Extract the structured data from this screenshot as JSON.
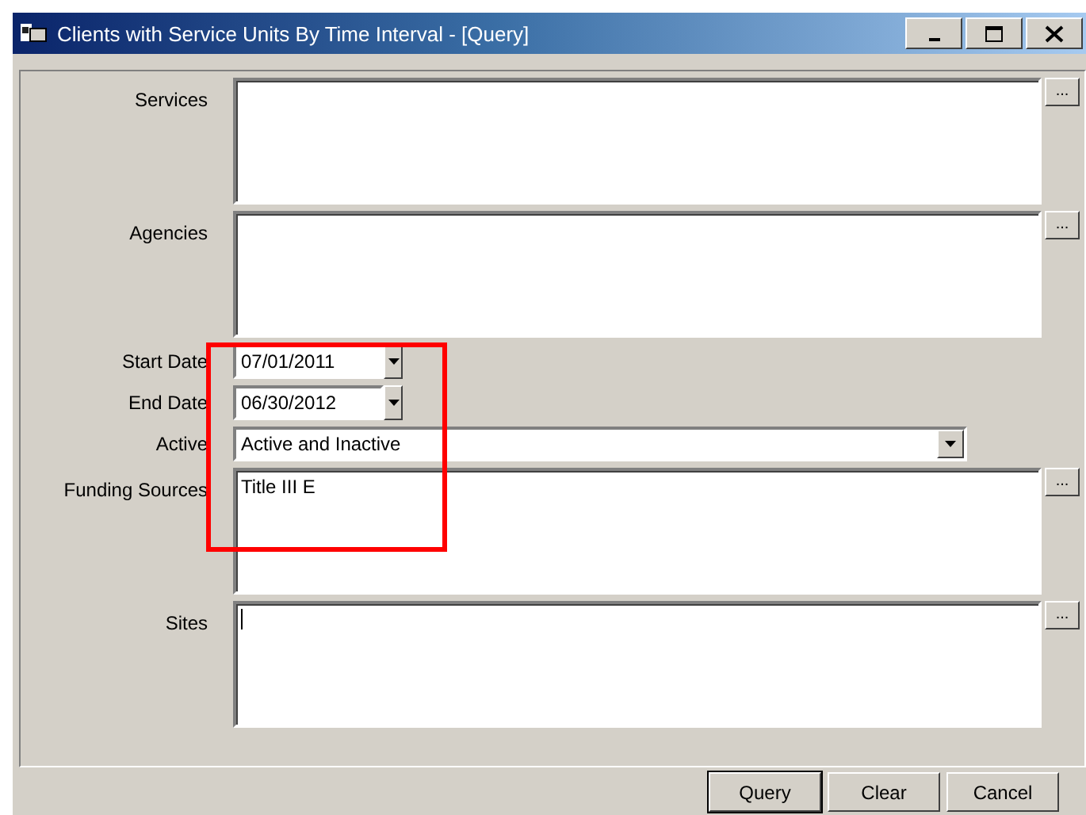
{
  "window": {
    "title": "Clients with Service Units By Time Interval - [Query]"
  },
  "fields": [
    {
      "label": "Services",
      "kind": "list",
      "browse": "..."
    },
    {
      "label": "Agencies",
      "kind": "list",
      "browse": "..."
    },
    {
      "label": "Start Date",
      "kind": "date",
      "value": "07/01/2011"
    },
    {
      "label": "End Date",
      "kind": "date",
      "value": "06/30/2012"
    },
    {
      "label": "Active",
      "kind": "combo",
      "value": "Active and Inactive"
    },
    {
      "label": "Funding Sources",
      "kind": "list",
      "value": "Title III E",
      "browse": "..."
    },
    {
      "label": "Sites",
      "kind": "list",
      "browse": "...",
      "focused": true
    }
  ],
  "buttons": [
    {
      "label": "Query",
      "default": true
    },
    {
      "label": "Clear",
      "default": false
    },
    {
      "label": "Cancel",
      "default": false
    }
  ],
  "highlight": {
    "kind": "frame"
  }
}
